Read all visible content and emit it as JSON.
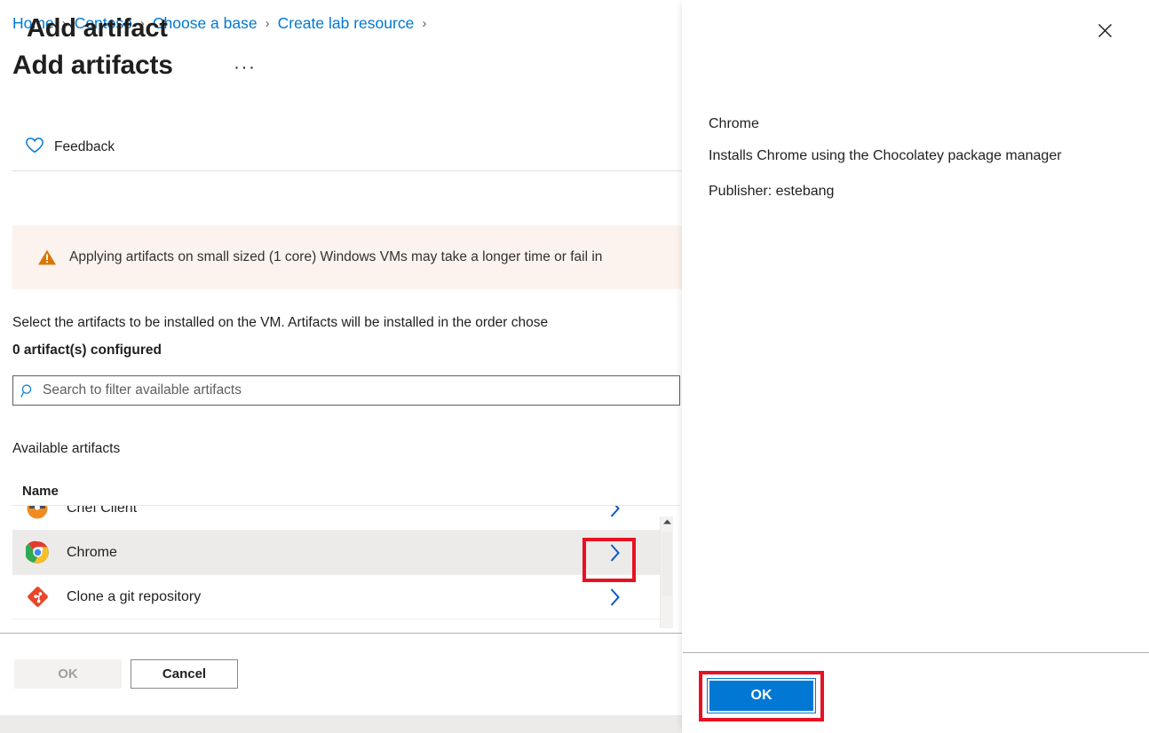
{
  "breadcrumb": {
    "items": [
      "Home",
      "Contoso",
      "Choose a base",
      "Create lab resource"
    ],
    "separator": "›"
  },
  "header": {
    "title": "Add artifacts",
    "ellipsis_label": "···"
  },
  "command_bar": {
    "feedback_label": "Feedback",
    "feedback_icon": "heart-icon"
  },
  "warning": {
    "icon": "warning-triangle-icon",
    "text": "Applying artifacts on small sized (1 core) Windows VMs may take a longer time or fail in"
  },
  "main": {
    "description": "Select the artifacts to be installed on the VM. Artifacts will be installed in the order chose",
    "configured_count": "0 artifact(s) configured",
    "available_label": "Available artifacts",
    "column_header_name": "Name"
  },
  "search": {
    "placeholder": "Search to filter available artifacts",
    "value": "",
    "icon": "search-icon"
  },
  "artifacts": [
    {
      "name": "Chef Client",
      "icon": "chef-client-icon",
      "selected": false,
      "chevron": "chevron-right-icon"
    },
    {
      "name": "Chrome",
      "icon": "chrome-icon",
      "selected": true,
      "chevron": "chevron-right-icon"
    },
    {
      "name": "Clone a git repository",
      "icon": "git-icon",
      "selected": false,
      "chevron": "chevron-right-icon"
    }
  ],
  "footer": {
    "ok_label": "OK",
    "cancel_label": "Cancel"
  },
  "context_pane": {
    "title": "Add artifact",
    "close_icon": "close-icon",
    "artifact_name": "Chrome",
    "artifact_description": "Installs Chrome using the Chocolatey package manager",
    "artifact_publisher": "Publisher: estebang",
    "ok_label": "OK"
  },
  "colors": {
    "accent": "#0078d4",
    "link": "#0078d4",
    "annotation": "#e81123",
    "warning_bg": "#fdf3ee",
    "warning_icon": "#d83b01",
    "row_selected_bg": "#edebe9"
  },
  "scrollbar": {
    "up_arrow_icon": "caret-up-icon"
  }
}
